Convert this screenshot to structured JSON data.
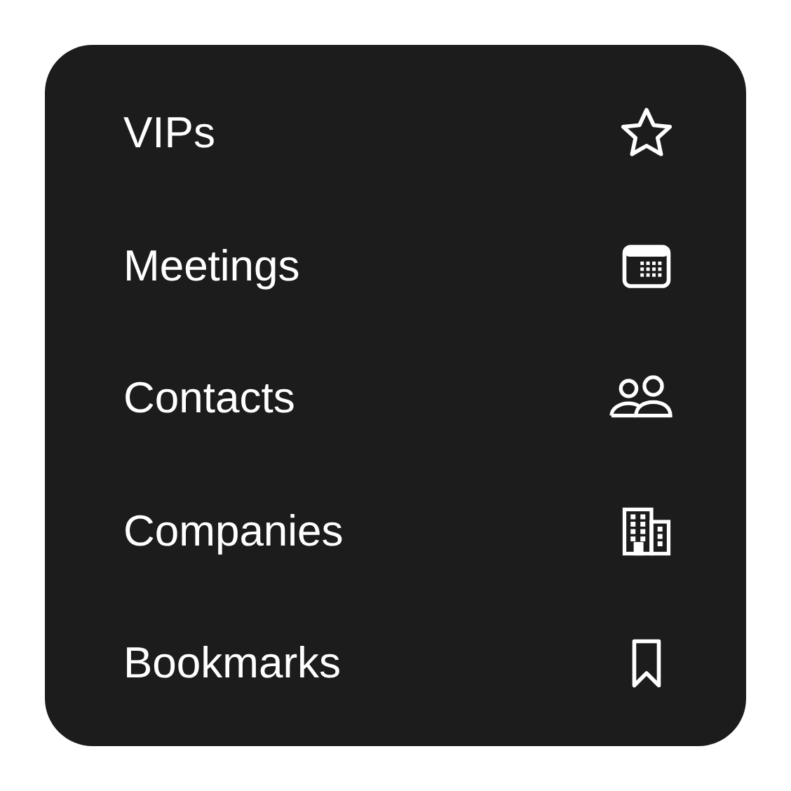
{
  "menu": {
    "items": [
      {
        "label": "VIPs",
        "kind": "star"
      },
      {
        "label": "Meetings",
        "kind": "calendar"
      },
      {
        "label": "Contacts",
        "kind": "people"
      },
      {
        "label": "Companies",
        "kind": "building"
      },
      {
        "label": "Bookmarks",
        "kind": "bookmark"
      }
    ]
  }
}
